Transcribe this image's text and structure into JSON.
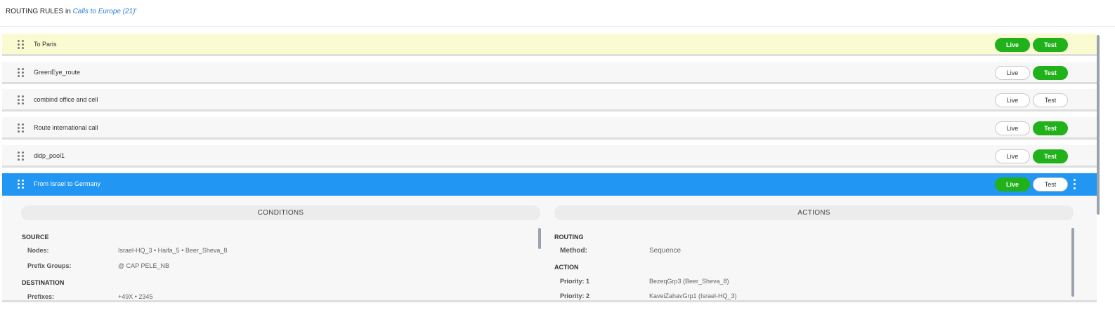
{
  "header": {
    "prefix": "ROUTING RULES in",
    "link": "Calls to Europe (21)",
    "suffix": "'"
  },
  "buttons": {
    "live": "Live",
    "test": "Test"
  },
  "rules": [
    {
      "name": "To Paris",
      "live_on": true,
      "test_on": true
    },
    {
      "name": "GreenEye_route",
      "live_on": false,
      "test_on": true
    },
    {
      "name": "combind office and cell",
      "live_on": false,
      "test_on": false
    },
    {
      "name": "Route international call",
      "live_on": false,
      "test_on": true
    },
    {
      "name": "didp_pool1",
      "live_on": false,
      "test_on": true
    },
    {
      "name": "From Israel to Germany",
      "live_on": true,
      "test_on": false
    }
  ],
  "colors": {
    "selected_row": "#2196f3",
    "highlight_row": "#fbfbd2",
    "toggle_on": "#21b11a",
    "link": "#2a7fd4"
  },
  "conditions": {
    "title": "CONDITIONS",
    "source": {
      "label": "SOURCE",
      "nodes_label": "Nodes:",
      "nodes_value": "Israel-HQ_3 • Haifa_5 • Beer_Sheva_8",
      "prefix_groups_label": "Prefix Groups:",
      "prefix_groups_value": "@ CAP PELE_NB"
    },
    "destination": {
      "label": "DESTINATION",
      "prefixes_label": "Prefixes:",
      "prefixes_value": "+49X • 2345"
    }
  },
  "actions": {
    "title": "ACTIONS",
    "routing": {
      "label": "ROUTING",
      "method_label": "Method:",
      "method_value": "Sequence"
    },
    "action": {
      "label": "ACTION",
      "p1_label": "Priority: 1",
      "p1_value": "BezeqGrp3 (Beer_Sheva_8)",
      "p2_label": "Priority: 2",
      "p2_value": "KaveiZahavGrp1 (Israel-HQ_3)"
    }
  }
}
